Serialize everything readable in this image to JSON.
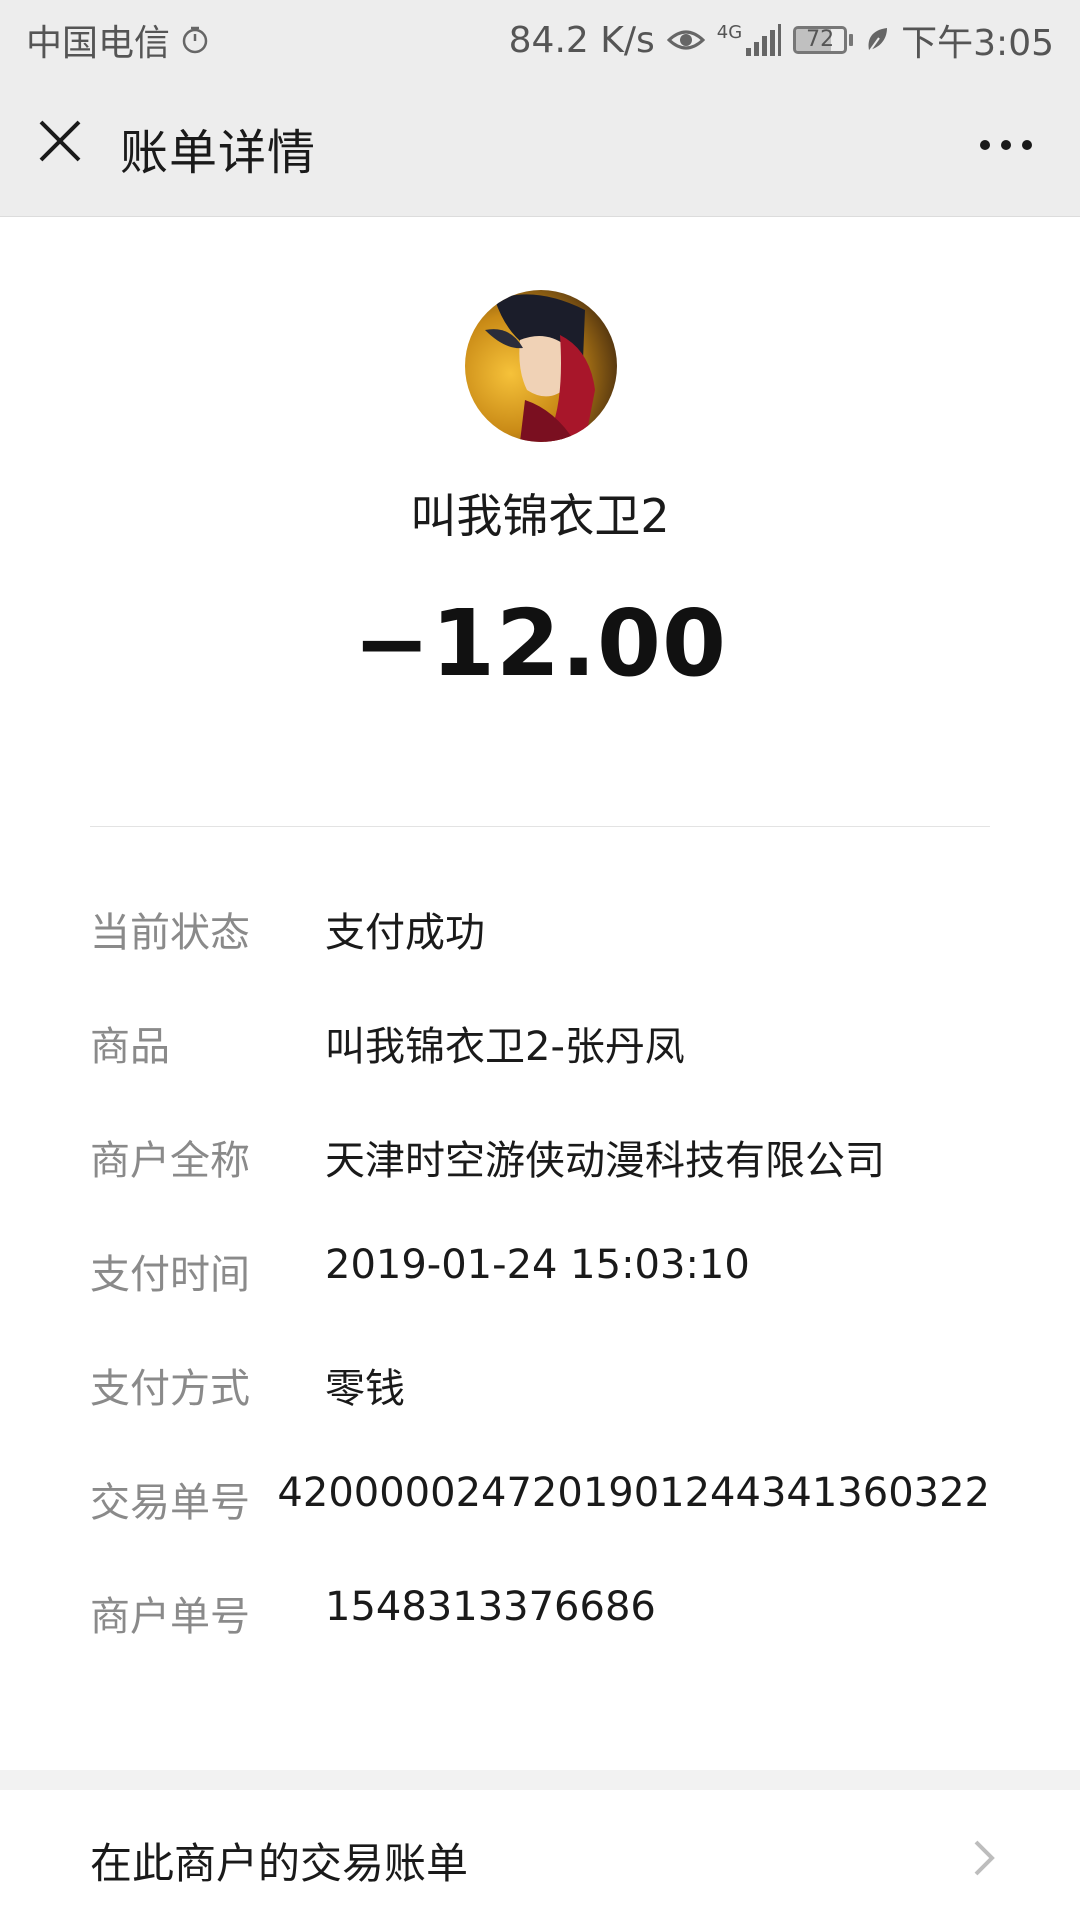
{
  "status_bar": {
    "carrier": "中国电信",
    "network_speed": "84.2 K/s",
    "network_type": "4G",
    "battery_level": "72",
    "battery_fraction": 0.72,
    "time": "下午3:05",
    "icons": [
      "alarm-icon",
      "eye-icon",
      "signal-icon",
      "battery-icon",
      "leaf-icon"
    ]
  },
  "header": {
    "title": "账单详情",
    "icons": [
      "close-icon",
      "more-icon"
    ]
  },
  "merchant": {
    "name": "叫我锦衣卫2",
    "amount": "−12.00"
  },
  "details": [
    {
      "label": "当前状态",
      "value": "支付成功"
    },
    {
      "label": "商品",
      "value": "叫我锦衣卫2-张丹凤"
    },
    {
      "label": "商户全称",
      "value": "天津时空游侠动漫科技有限公司"
    },
    {
      "label": "支付时间",
      "value": "2019-01-24 15:03:10"
    },
    {
      "label": "支付方式",
      "value": "零钱"
    },
    {
      "label": "交易单号",
      "value": "4200000247201901244341360322"
    },
    {
      "label": "商户单号",
      "value": "1548313376686"
    }
  ],
  "footer": {
    "merchant_bills_label": "在此商户的交易账单"
  },
  "colors": {
    "bar_background": "#ededed",
    "label_gray": "#8a8a8a",
    "text_dark": "#1a1a1a"
  }
}
